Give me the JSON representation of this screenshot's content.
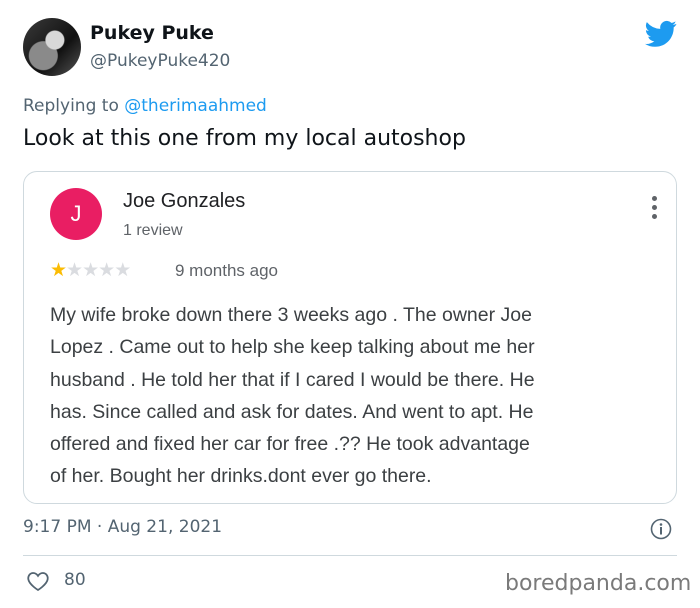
{
  "tweet": {
    "display_name": "Pukey Puke",
    "handle": "@PukeyPuke420",
    "replying_to_prefix": "Replying to ",
    "replying_to_handle": "@therimaahmed",
    "text": "Look at this one from my local autoshop",
    "timestamp": "9:17 PM · Aug 21, 2021",
    "likes": "80",
    "brand_color": "#1d9bf0"
  },
  "review": {
    "avatar_letter": "J",
    "avatar_color": "#e91e63",
    "reviewer_name": "Joe Gonzales",
    "review_count": "1 review",
    "rating": 1,
    "max_rating": 5,
    "time_ago": "9 months ago",
    "lines": [
      "My wife broke down there 3 weeks ago . The owner Joe",
      "Lopez . Came out to help she keep talking about me her",
      "husband . He told her that if I cared I would be there. He",
      "has. Since called and ask for dates. And went to apt. He",
      "offered and fixed her car for free .?? He took advantage",
      "of her. Bought her drinks.dont ever go there."
    ]
  },
  "watermark": "boredpanda.com",
  "icons": {
    "brand": "twitter-bird-icon",
    "overflow": "more-vert-icon",
    "info": "info-icon",
    "like": "heart-icon"
  }
}
